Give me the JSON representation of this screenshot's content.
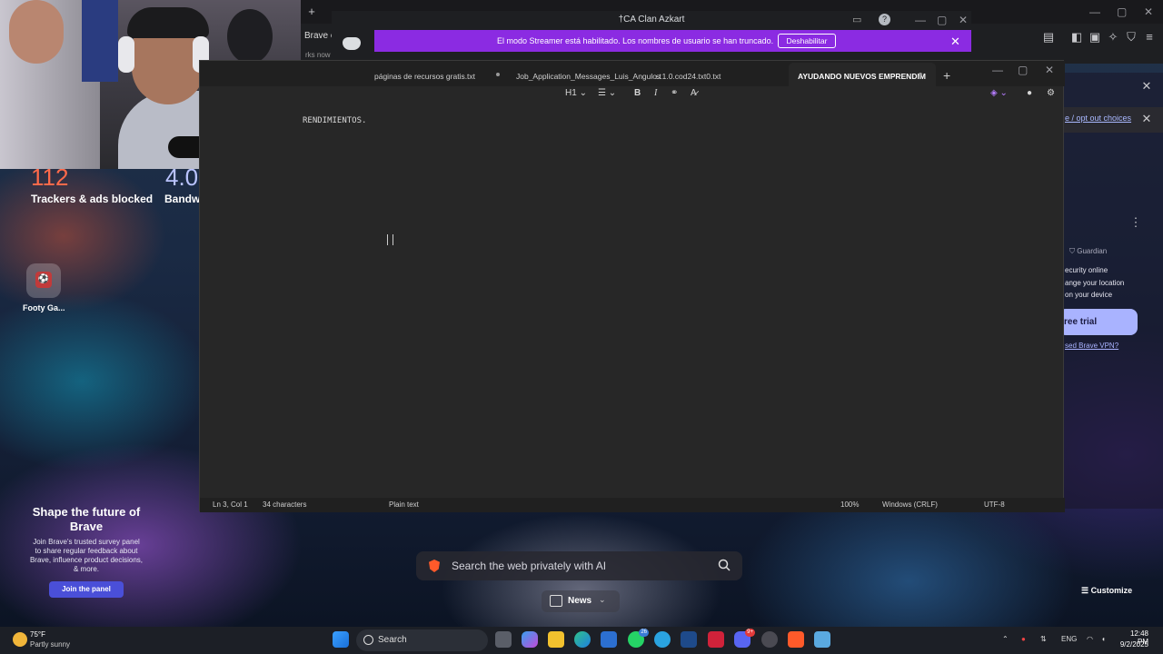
{
  "browser": {
    "partial_tab_label": "Brave c",
    "partial_url": "rks now",
    "bg_text": {
      "privacy_link": "e / opt out choices",
      "vpn_guardian": "Guardian",
      "vpn_line1": "ecurity online",
      "vpn_line2": "ange your location",
      "vpn_line3": "on your device",
      "vpn_trial": "ree trial",
      "vpn_link": "sed Brave VPN?"
    }
  },
  "stats": {
    "trackers_value": "112",
    "trackers_label": "Trackers & ads blocked",
    "bandwidth_value": "4.0",
    "bandwidth_label": "Bandw"
  },
  "top_site": {
    "label": "Footy Ga..."
  },
  "survey": {
    "title": "Shape the future of Brave",
    "body": "Join Brave's trusted survey panel to share regular feedback about Brave, influence product decisions, & more.",
    "button": "Join the panel"
  },
  "search": {
    "placeholder": "Search the web privately with AI"
  },
  "news": {
    "label": "News"
  },
  "customize": {
    "label": "Customize"
  },
  "discord": {
    "title": "Clan Azkart",
    "title_prefix": "†CA",
    "banner": "El modo Streamer está habilitado. Los nombres de usuario se han truncado.",
    "disable_button": "Deshabilitar"
  },
  "notepad": {
    "tabs": [
      {
        "label": "páginas de recursos gratis.txt"
      },
      {
        "label": "Job_Application_Messages_Luis_Angulo.t"
      },
      {
        "label": "s.1.0.cod24.txt0.txt"
      },
      {
        "label": "AYUDANDO NUEVOS EMPRENDIM"
      }
    ],
    "toolbar": {
      "heading": "H1"
    },
    "content": "RENDIMIENTOS.",
    "status": {
      "position": "Ln 3, Col 1",
      "characters": "34 characters",
      "format": "Plain text",
      "zoom": "100%",
      "line_endings": "Windows (CRLF)",
      "encoding": "UTF-8"
    }
  },
  "taskbar": {
    "weather_temp": "75°F",
    "weather_cond": "Partly sunny",
    "search_label": "Search",
    "lang": "ENG",
    "time": "12:48 PM",
    "date": "9/2/2025",
    "whatsapp_badge": "26",
    "discord_badge": "9+"
  },
  "colors": {
    "discord_banner": "#8b2be2",
    "brave_orange": "#ff5a2a",
    "tracker_count": "#ff6a4a",
    "join_button": "#4a4fd8"
  }
}
